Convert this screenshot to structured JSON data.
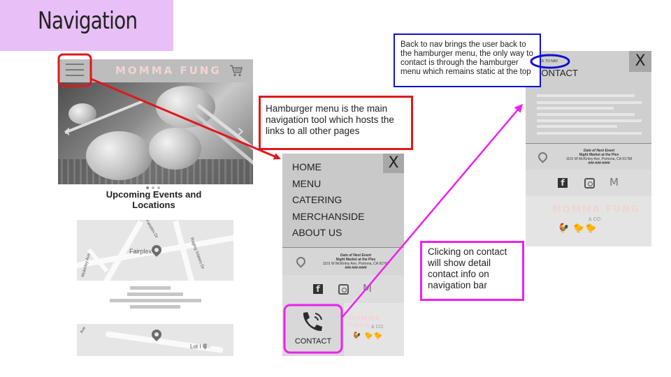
{
  "slide": {
    "title": "Navigation"
  },
  "home_screen": {
    "brand": "MOMMA FUNG",
    "menu_icon": "hamburger-icon",
    "cart_icon": "cart-icon",
    "events_title": "Upcoming Events and Locations",
    "map1_place": "Fairplex",
    "map1_road1": "Fairplex Dr",
    "map1_road2": "Raging Waters Dr",
    "map1_road3": "Mckinley Ave",
    "map2_label": "Lot I",
    "map2_road": "Ave"
  },
  "menu_screen": {
    "close_label": "X",
    "items": [
      "HOME",
      "MENU",
      "CATERING",
      "MERCHANSIDE",
      "ABOUT US"
    ],
    "event": {
      "line1": "Date of Next Event",
      "line2": "Night Market at the Plex",
      "line3": "1101 W McKinley Ave, Pomona, CA 91768",
      "line4": "###-###-####"
    },
    "contact_label": "CONTACT",
    "logo_brand": "MOMMA FUNG",
    "logo_co": "& CO."
  },
  "contact_screen": {
    "back_label": "BACK TO NAV",
    "heading": "CONTACT",
    "close_label": "X",
    "event": {
      "line1": "Date of Next Event",
      "line2": "Night Market at the Plex",
      "line3": "1101 W McKinley Ave, Pomona, CA 91768",
      "line4": "###-###-####"
    },
    "logo_brand": "MOMMA FUNG",
    "logo_co": "& CO."
  },
  "annotations": {
    "hamburger_note": "Hamburger menu is the main navigation tool which hosts the links to all other pages",
    "back_note": "Back to nav brings the user back to the hamburger menu, the only way to contact is through the hamburger menu which remains static at the top",
    "contact_note": "Clicking on contact will show detail contact info on navigation bar"
  },
  "colors": {
    "title_bg": "#e8bff6",
    "red": "#e0181b",
    "magenta": "#ee20ee",
    "blue": "#1010d0"
  }
}
